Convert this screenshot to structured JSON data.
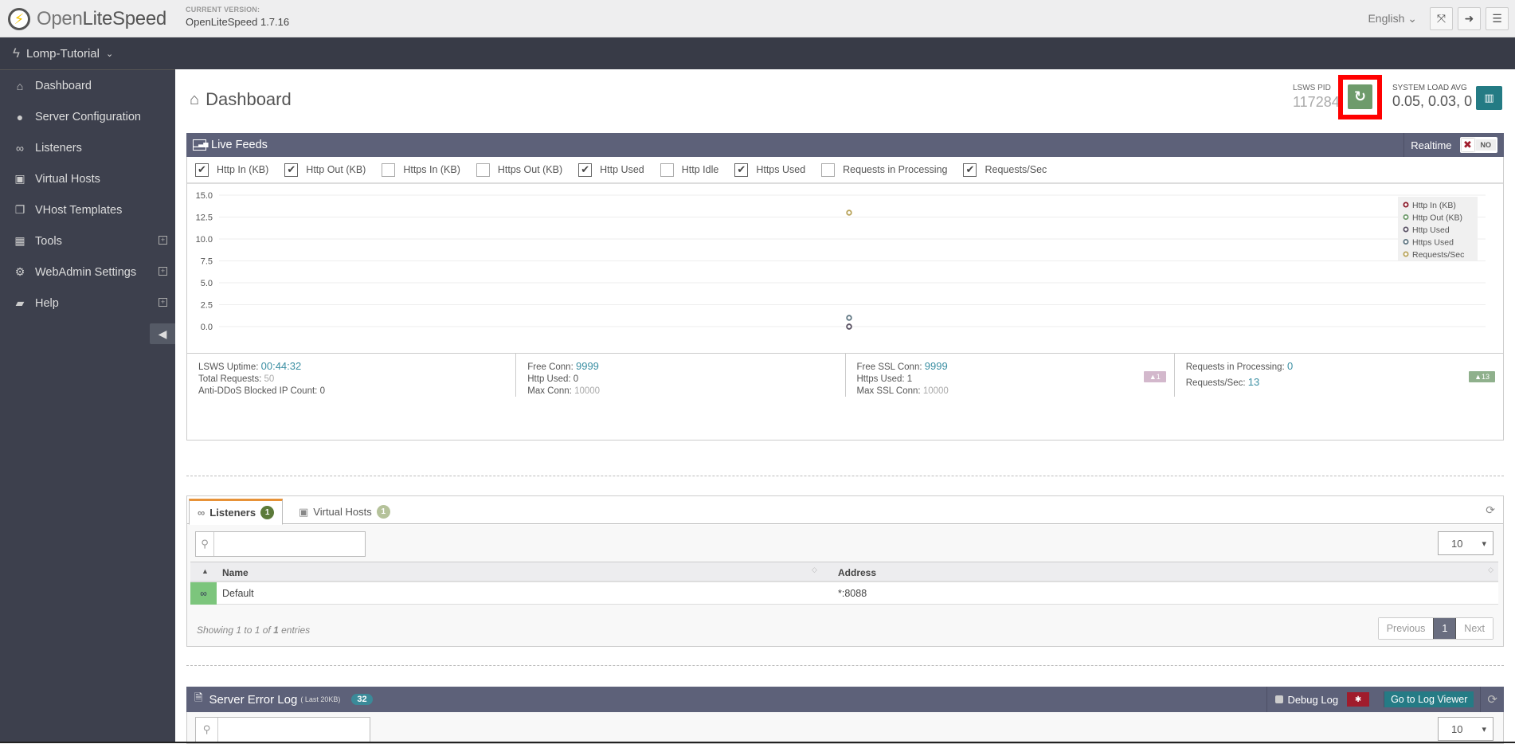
{
  "topbar": {
    "brand_light": "Open",
    "brand_bold": "LiteSpeed",
    "version_label": "CURRENT VERSION:",
    "version_value": "OpenLiteSpeed 1.7.16",
    "language": "English",
    "icons": [
      "fullscreen-icon",
      "logout-icon",
      "menu-icon"
    ]
  },
  "navbar": {
    "server_name": "Lomp-Tutorial"
  },
  "sidebar": {
    "items": [
      {
        "label": "Dashboard",
        "icon": "home-icon",
        "expandable": false
      },
      {
        "label": "Server Configuration",
        "icon": "globe-icon",
        "expandable": false
      },
      {
        "label": "Listeners",
        "icon": "link-icon",
        "expandable": false
      },
      {
        "label": "Virtual Hosts",
        "icon": "cubes-icon",
        "expandable": false
      },
      {
        "label": "VHost Templates",
        "icon": "copy-icon",
        "expandable": false
      },
      {
        "label": "Tools",
        "icon": "grid-icon",
        "expandable": true
      },
      {
        "label": "WebAdmin Settings",
        "icon": "gear-icon",
        "expandable": true
      },
      {
        "label": "Help",
        "icon": "book-icon",
        "expandable": true
      }
    ]
  },
  "header": {
    "title": "Dashboard",
    "pid_label": "LSWS PID",
    "pid_value": "117284",
    "load_label": "SYSTEM LOAD AVG",
    "load_value": "0.05, 0.03, 0"
  },
  "live_feeds": {
    "title": "Live Feeds",
    "realtime_label": "Realtime",
    "realtime_state": "NO",
    "checkboxes": [
      {
        "label": "Http In (KB)",
        "checked": true
      },
      {
        "label": "Http Out (KB)",
        "checked": true
      },
      {
        "label": "Https In (KB)",
        "checked": false
      },
      {
        "label": "Https Out (KB)",
        "checked": false
      },
      {
        "label": "Http Used",
        "checked": true
      },
      {
        "label": "Http Idle",
        "checked": false
      },
      {
        "label": "Https Used",
        "checked": true
      },
      {
        "label": "Requests in Processing",
        "checked": false
      },
      {
        "label": "Requests/Sec",
        "checked": true
      }
    ]
  },
  "chart_data": {
    "type": "scatter",
    "title": "",
    "xlabel": "",
    "ylabel": "",
    "ylim": [
      0,
      15
    ],
    "yticks": [
      "0.0",
      "2.5",
      "5.0",
      "7.5",
      "10.0",
      "12.5",
      "15.0"
    ],
    "grid": true,
    "legend_position": "top-right",
    "series": [
      {
        "name": "Http In (KB)",
        "color": "#8b1a2a",
        "values": [
          0
        ]
      },
      {
        "name": "Http Out (KB)",
        "color": "#6e9b6b",
        "values": [
          0
        ]
      },
      {
        "name": "Http Used",
        "color": "#5d5568",
        "values": [
          0
        ]
      },
      {
        "name": "Https Used",
        "color": "#5f7682",
        "values": [
          1
        ]
      },
      {
        "name": "Requests/Sec",
        "color": "#b8a35a",
        "values": [
          13
        ]
      }
    ]
  },
  "stats": {
    "uptime_label": "LSWS Uptime:",
    "uptime_value": "00:44:32",
    "total_requests_label": "Total Requests:",
    "total_requests_value": "50",
    "ddos_label": "Anti-DDoS Blocked IP Count:",
    "ddos_value": "0",
    "free_conn_label": "Free Conn:",
    "free_conn_value": "9999",
    "http_used_label": "Http Used:",
    "http_used_value": "0",
    "max_conn_label": "Max Conn:",
    "max_conn_value": "10000",
    "free_ssl_label": "Free SSL Conn:",
    "free_ssl_value": "9999",
    "https_used_label": "Https Used:",
    "https_used_value": "1",
    "max_ssl_label": "Max SSL Conn:",
    "max_ssl_value": "10000",
    "https_tag": "▲1",
    "req_proc_label": "Requests in Processing:",
    "req_proc_value": "0",
    "req_sec_label": "Requests/Sec:",
    "req_sec_value": "13",
    "req_tag": "▲13"
  },
  "tabs_panel": {
    "tabs": [
      {
        "label": "Listeners",
        "count": "1",
        "active": true
      },
      {
        "label": "Virtual Hosts",
        "count": "1",
        "active": false
      }
    ],
    "search_placeholder": "",
    "page_size": "10",
    "columns": [
      "Name",
      "Address"
    ],
    "rows": [
      {
        "name": "Default",
        "address": "*:8088"
      }
    ],
    "showing_prefix": "Showing 1 to 1 of ",
    "showing_total": "1",
    "showing_suffix": " entries",
    "pager": {
      "prev": "Previous",
      "current": "1",
      "next": "Next"
    }
  },
  "error_log": {
    "title": "Server Error Log",
    "subtitle": "( Last 20KB)",
    "count": "32",
    "debug_label": "Debug Log",
    "go_label": "Go to Log Viewer",
    "page_size": "10"
  }
}
